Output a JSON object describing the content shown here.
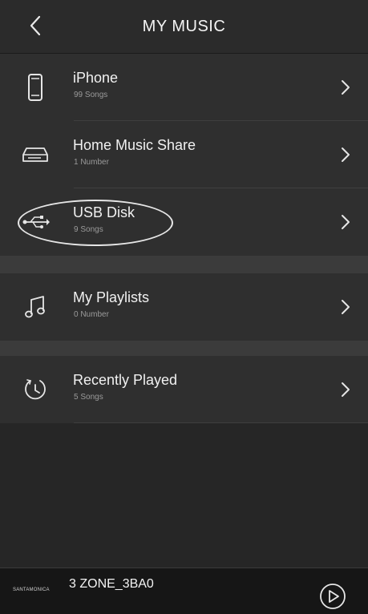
{
  "header": {
    "title": "MY MUSIC",
    "back_icon": "chevron-left-icon"
  },
  "sources": [
    {
      "title": "iPhone",
      "subtitle": "99 Songs",
      "icon": "phone-icon"
    },
    {
      "title": "Home Music Share",
      "subtitle": "1 Number",
      "icon": "hard-drive-icon"
    },
    {
      "title": "USB Disk",
      "subtitle": "9 Songs",
      "icon": "usb-icon",
      "highlighted": true
    }
  ],
  "playlists": [
    {
      "title": "My Playlists",
      "subtitle": "0 Number",
      "icon": "music-note-icon"
    }
  ],
  "recent": [
    {
      "title": "Recently Played",
      "subtitle": "5 Songs",
      "icon": "clock-icon"
    }
  ],
  "player": {
    "logo_text": "SANTAMONICA",
    "zone_name": "3 ZONE_3BA0",
    "play_icon": "play-circle-icon"
  },
  "colors": {
    "background": "#262626",
    "row": "#2f2f2f",
    "section_gap": "#3b3b3b",
    "player_bar": "#161616",
    "text": "#f1f1f1",
    "subtext": "#9a9a9a"
  }
}
